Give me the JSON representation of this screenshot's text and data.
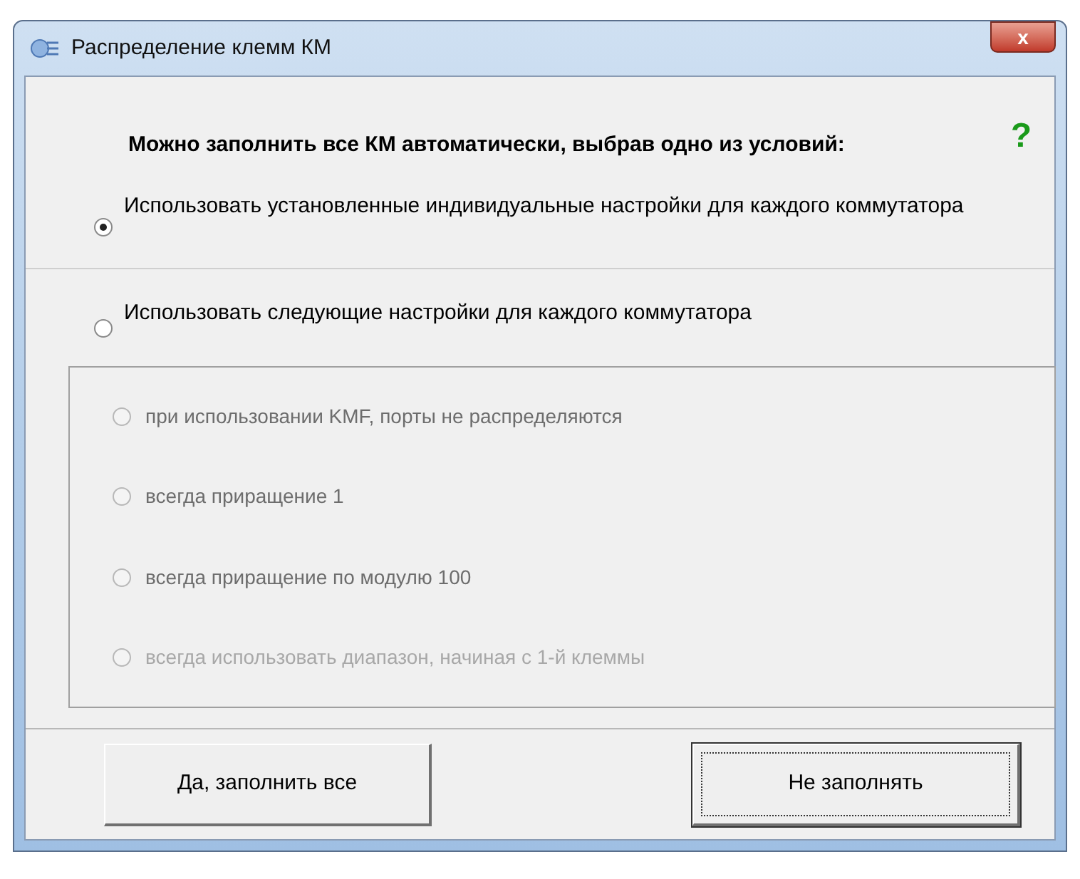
{
  "window": {
    "title": "Распределение клемм КМ",
    "close": "x"
  },
  "help": "?",
  "heading": "Можно заполнить все КМ автоматически, выбрав одно из условий:",
  "modes": [
    {
      "label": "Использовать установленные индивидуальные настройки для каждого коммутатора",
      "selected": true
    },
    {
      "label": "Использовать следующие настройки для каждого коммутатора",
      "selected": false
    }
  ],
  "options": [
    {
      "label": "при использовании KMF, порты не распределяются",
      "selected": false,
      "disabled": true
    },
    {
      "label": "всегда приращение 1",
      "selected": false,
      "disabled": true
    },
    {
      "label": "всегда приращение по модулю 100",
      "selected": false,
      "disabled": true
    },
    {
      "label": "всегда использовать диапазон, начиная с 1-й клеммы",
      "selected": false,
      "disabled": true
    }
  ],
  "buttons": [
    {
      "label": "Да, заполнить все",
      "focused": false
    },
    {
      "label": "Не заполнять",
      "focused": true
    }
  ]
}
